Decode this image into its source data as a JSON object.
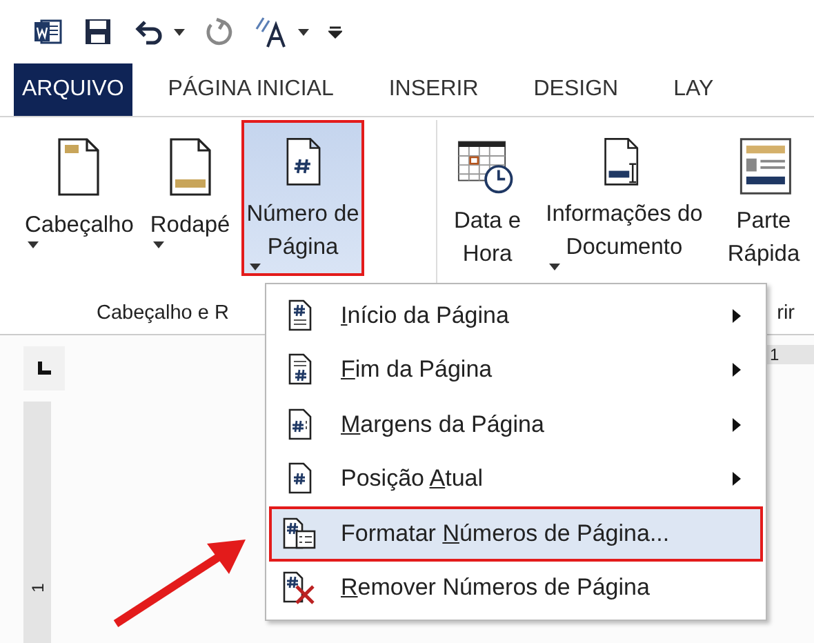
{
  "quick_access": {
    "undo_dropdown": true
  },
  "tabs": [
    {
      "label": "ARQUIVO",
      "selected": true
    },
    {
      "label": "PÁGINA INICIAL",
      "selected": false
    },
    {
      "label": "INSERIR",
      "selected": false
    },
    {
      "label": "DESIGN",
      "selected": false
    },
    {
      "label": "LAY",
      "selected": false
    }
  ],
  "ribbon": {
    "groups": [
      {
        "label": "Cabeçalho e R",
        "buttons": [
          {
            "kind": "header",
            "lines": [
              "Cabeçalho"
            ],
            "dropdown": true,
            "selected": false,
            "highlighted": false
          },
          {
            "kind": "footer",
            "lines": [
              "Rodapé"
            ],
            "dropdown": true,
            "selected": false,
            "highlighted": false
          },
          {
            "kind": "page-number",
            "lines": [
              "Número de",
              "Página"
            ],
            "dropdown": true,
            "selected": true,
            "highlighted": true
          }
        ]
      },
      {
        "label": "rir",
        "buttons": [
          {
            "kind": "date-time",
            "lines": [
              "Data e",
              "Hora"
            ],
            "dropdown": false,
            "selected": false,
            "highlighted": false
          },
          {
            "kind": "doc-info",
            "lines": [
              "Informações do",
              "Documento"
            ],
            "dropdown": true,
            "selected": false,
            "highlighted": false
          },
          {
            "kind": "quick-parts",
            "lines": [
              "Parte",
              "Rápida"
            ],
            "dropdown": false,
            "selected": false,
            "highlighted": false
          }
        ]
      }
    ]
  },
  "ruler": {
    "horizontal_mark": "1",
    "vertical_mark": "1"
  },
  "menu": {
    "items": [
      {
        "kind": "top",
        "key": "I",
        "post": "nício da Página",
        "submenu": true,
        "selected": false
      },
      {
        "kind": "bottom",
        "key": "F",
        "post": "im da Página",
        "submenu": true,
        "selected": false
      },
      {
        "kind": "margins",
        "key": "M",
        "post": "argens da Página",
        "submenu": true,
        "selected": false
      },
      {
        "kind": "current",
        "pre": "Posição ",
        "key": "A",
        "post": "tual",
        "submenu": true,
        "selected": false
      },
      {
        "kind": "format",
        "pre": "Formatar ",
        "key": "N",
        "post": "úmeros de Página...",
        "submenu": false,
        "selected": true
      },
      {
        "kind": "remove",
        "key": "R",
        "post": "emover Números de Página",
        "submenu": false,
        "selected": false
      }
    ]
  }
}
